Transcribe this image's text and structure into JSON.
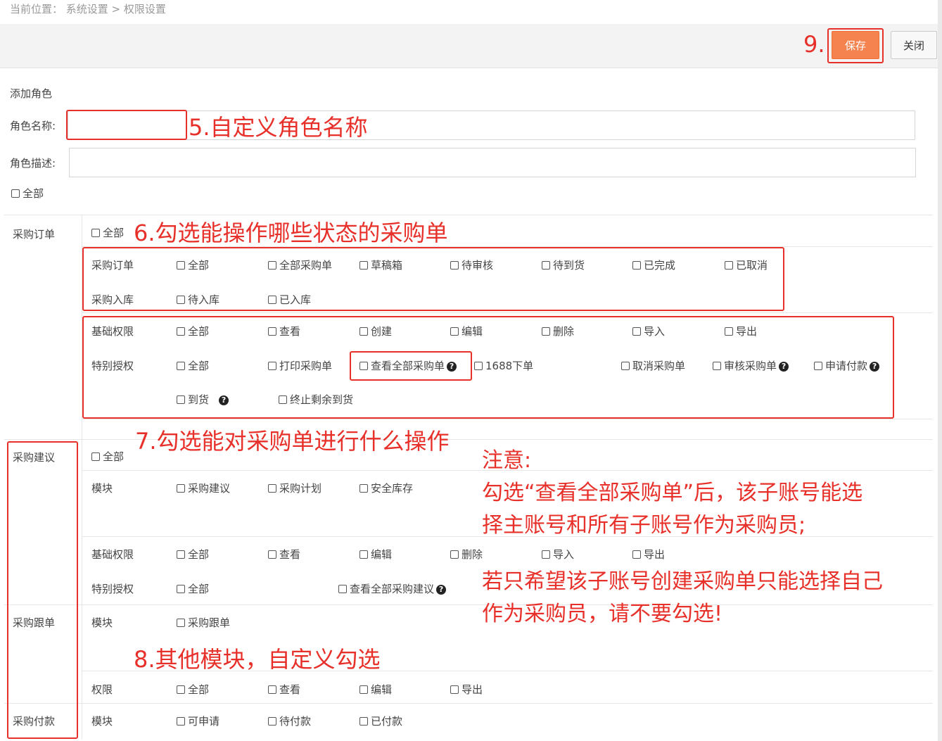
{
  "breadcrumb": "当前位置： 系统设置 > 权限设置",
  "toolbar": {
    "save_label": "保存",
    "close_label": "关闭"
  },
  "form": {
    "section_title": "添加角色",
    "name_label": "角色名称:",
    "desc_label": "角色描述:",
    "all_label": "全部"
  },
  "sections": {
    "purchase_order": {
      "name": "采购订单",
      "all": "全部",
      "rows": [
        {
          "label": "采购订单",
          "options": [
            "全部",
            "全部采购单",
            "草稿箱",
            "待审核",
            "待到货",
            "已完成",
            "已取消"
          ]
        },
        {
          "label": "采购入库",
          "options": [
            "待入库",
            "已入库"
          ]
        },
        {
          "label": "基础权限",
          "options": [
            "全部",
            "查看",
            "创建",
            "编辑",
            "删除",
            "导入",
            "导出"
          ]
        },
        {
          "label": "特别授权",
          "options": [
            "全部",
            "打印采购单",
            "查看全部采购单",
            "1688下单",
            "取消采购单",
            "审核采购单",
            "申请付款",
            "到货",
            "终止剩余到货"
          ]
        }
      ]
    },
    "purchase_suggest": {
      "name": "采购建议",
      "all": "全部",
      "rows": [
        {
          "label": "模块",
          "options": [
            "采购建议",
            "采购计划",
            "安全库存"
          ]
        },
        {
          "label": "基础权限",
          "options": [
            "全部",
            "查看",
            "编辑",
            "删除",
            "导入",
            "导出"
          ]
        },
        {
          "label": "特别授权",
          "options": [
            "全部",
            "查看全部采购建议"
          ]
        }
      ]
    },
    "purchase_follow": {
      "name": "采购跟单",
      "rows": [
        {
          "label": "模块",
          "options": [
            "采购跟单"
          ]
        },
        {
          "label": "权限",
          "options": [
            "全部",
            "查看",
            "编辑",
            "导出"
          ]
        }
      ]
    },
    "purchase_pay": {
      "name": "采购付款",
      "rows": [
        {
          "label": "模块",
          "options": [
            "可申请",
            "待付款",
            "已付款"
          ]
        }
      ]
    }
  },
  "annotations": {
    "step9": "9.",
    "step5": "5.自定义角色名称",
    "step6": "6.勾选能操作哪些状态的采购单",
    "step7": "7.勾选能对采购单进行什么操作",
    "step8": "8.其他模块，自定义勾选",
    "note_title": "注意:",
    "note_line1": "勾选“查看全部采购单”后，该子账号能选",
    "note_line2": "择主账号和所有子账号作为采购员;",
    "note_line3": "若只希望该子账号创建采购单只能选择自己",
    "note_line4": "作为采购员，请不要勾选!"
  },
  "colors": {
    "accent": "#f4834f",
    "annotation": "#e8302a"
  }
}
